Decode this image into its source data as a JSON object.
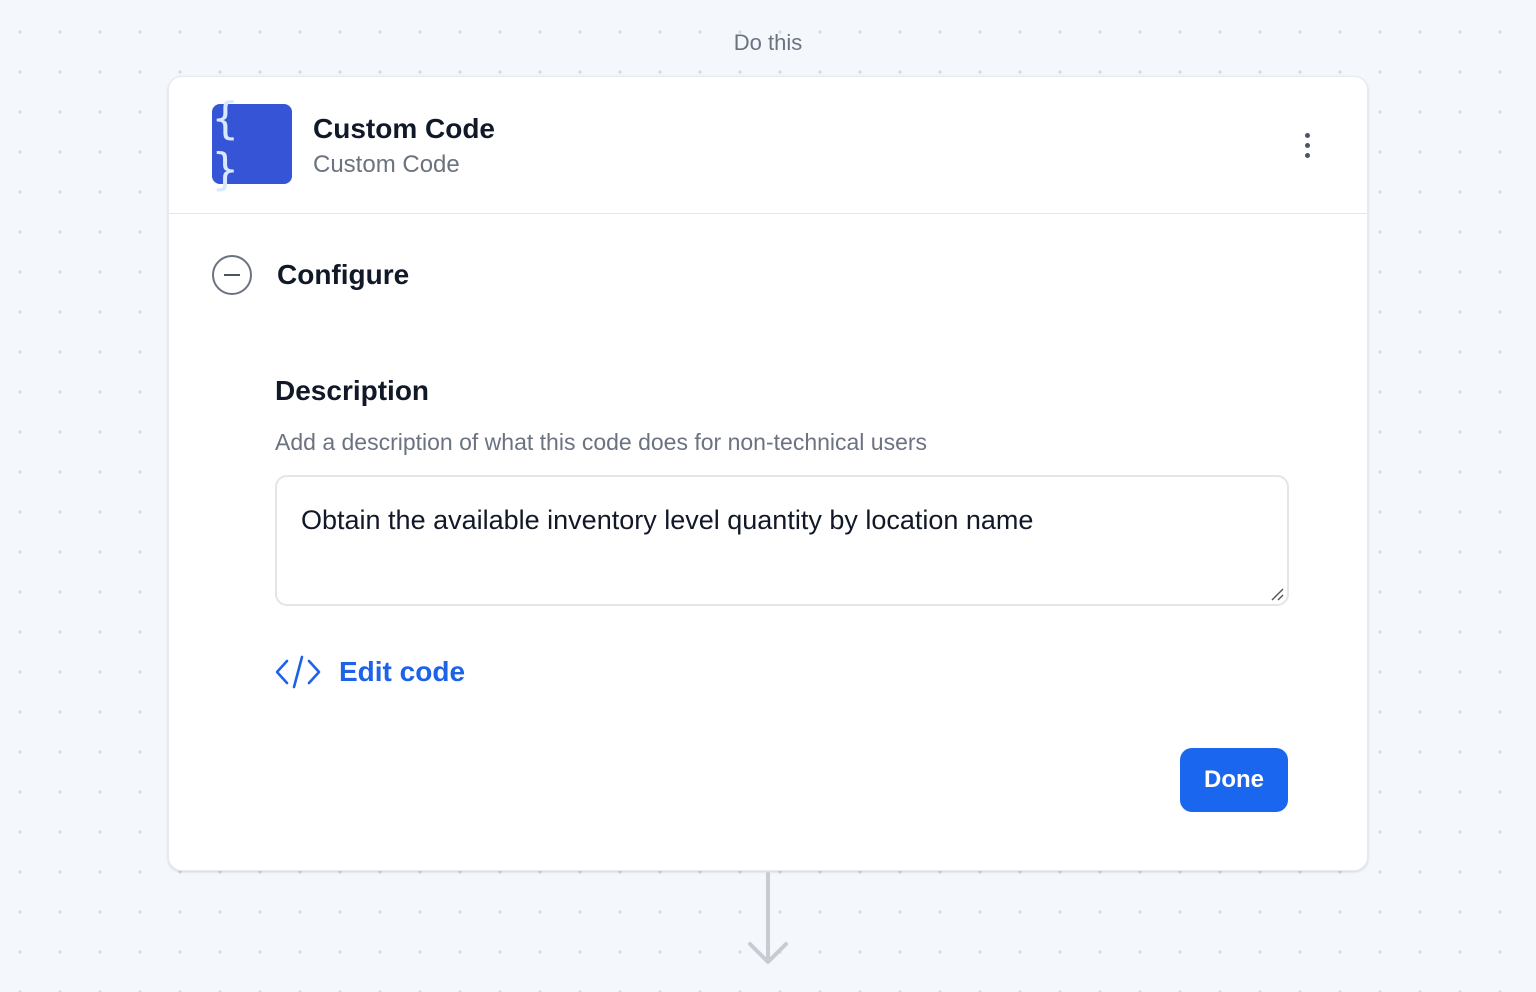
{
  "canvas": {
    "step_label": "Do this"
  },
  "step": {
    "app_icon": "curly-braces-icon",
    "app_icon_glyph": "{ }",
    "title": "Custom Code",
    "subtitle": "Custom Code",
    "menu_icon": "kebab-menu-icon"
  },
  "configure": {
    "title": "Configure",
    "toggle_icon": "collapse-minus-icon",
    "description": {
      "label": "Description",
      "help": "Add a description of what this code does for non-technical users",
      "value": "Obtain the available inventory level quantity by location name"
    },
    "edit_code_label": "Edit code",
    "edit_code_icon": "code-icon",
    "done_label": "Done"
  },
  "colors": {
    "accent": "#1a66ef",
    "app_icon_bg": "#3654d6"
  }
}
